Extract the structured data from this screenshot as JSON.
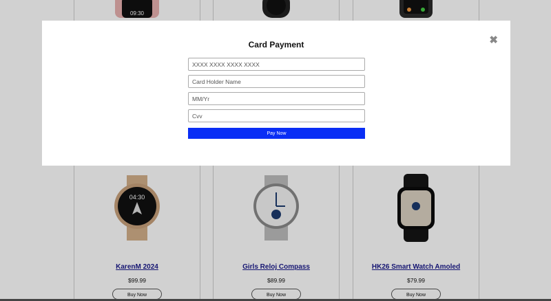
{
  "modal": {
    "title": "Card Payment",
    "close_glyph": "✖",
    "card_number_placeholder": "XXXX XXXX XXXX XXXX",
    "holder_placeholder": "Card Holder Name",
    "expiry_placeholder": "MM/Yr",
    "cvv_placeholder": "Cvv",
    "pay_label": "Pay Now",
    "pay_color": "#0a2ef5"
  },
  "products": [
    {
      "name": "KarenM 2024",
      "price": "$99.99",
      "buy_label": "Buy Now",
      "image": "rose-gold-watch"
    },
    {
      "name": "Girls Reloj Compass",
      "price": "$89.99",
      "buy_label": "Buy Now",
      "image": "silver-watch"
    },
    {
      "name": "HK26 Smart Watch Amoled",
      "price": "$79.99",
      "buy_label": "Buy Now",
      "image": "black-smartwatch"
    }
  ],
  "top_watch_time": "09:30",
  "icons": [
    "close-icon"
  ]
}
